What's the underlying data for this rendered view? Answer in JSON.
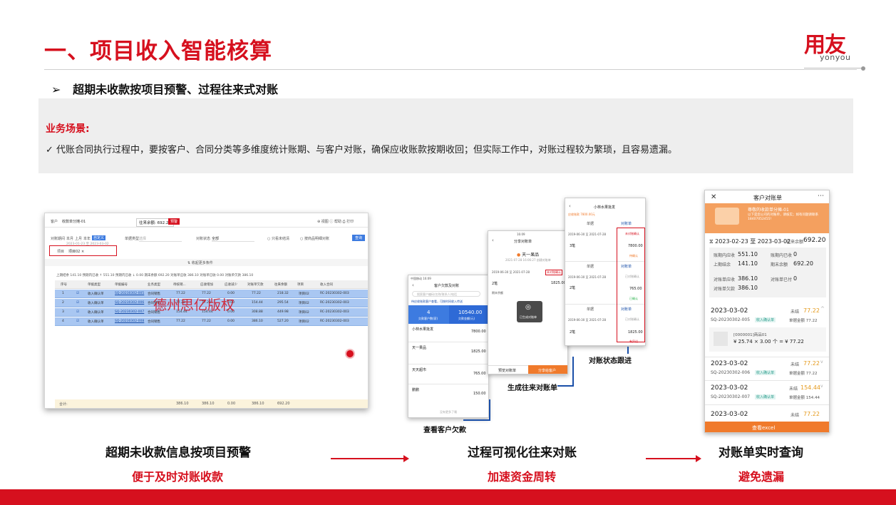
{
  "header": {
    "title": "一、项目收入智能核算",
    "logo_main": "用友",
    "logo_sub": "yonyou"
  },
  "subtitle": {
    "bullet": "➢",
    "text": "超期未收款按项目预警、过程往来式对账"
  },
  "scenario": {
    "title": "业务场景:",
    "text": "✓ 代账合同执行过程中，要按客户、合同分类等多维度统计账期、与客户对账，确保应收账款按期收回；但实际工作中，对账过程较为繁琐，且容易遗漏。"
  },
  "shot1": {
    "customer_label": "客户",
    "customer_value": "收款单分摊-01",
    "balance": "往来余额: 692.20",
    "tag": "预警",
    "toolbar": "⊕ 视图  ⓘ 帮助  ⎙ 打印",
    "filter_period_label": "对账期间",
    "filter_periods": [
      "本月",
      "上月",
      "本年",
      "自定义"
    ],
    "date_range": "2023-01-23 至 2023-03-02",
    "filter_type_label": "单据类型",
    "filter_type_value": "选择",
    "filter_status_label": "对账状态",
    "filter_status_value": "全部",
    "check1": "只看未结清",
    "check2": "按商品明细对账",
    "query_button": "查询",
    "project_label": "项目",
    "project_value": "项目02 ×",
    "more_filters": "⇅ 收起更多条件",
    "summary": "上期结余  141.10    预期内已收  ↑ 551.10    预期内已收  ↓ 0.00    期末余额  692.20        对账单应收  386.10    对账单已收  0.00    对账单欠款  386.10",
    "columns": [
      "序号",
      "单据类型",
      "单据编号",
      "业务类型",
      "待核销...",
      "应收增加",
      "应收减少",
      "对账单欠款",
      "往来余额",
      "项目",
      "收入合同"
    ],
    "rows": [
      [
        "1",
        "收入确认单",
        "SQ-20230302-005",
        "合同销售",
        "77.22",
        "77.22",
        "0.00",
        "77.22",
        "218.32",
        "项目02",
        "RC-20230302-003"
      ],
      [
        "2",
        "收入确认单",
        "SQ-20230302-006",
        "合同销售",
        "77.22",
        "77.22",
        "0.00",
        "154.44",
        "295.54",
        "项目02",
        "RC-20230302-003"
      ],
      [
        "3",
        "收入确认单",
        "SQ-20230302-007",
        "合同销售",
        "154.44",
        "154.44",
        "0.00",
        "308.88",
        "449.98",
        "项目02",
        "RC-20230302-003"
      ],
      [
        "4",
        "收入确认单",
        "SQ-20230302-008",
        "合同销售",
        "77.22",
        "77.22",
        "0.00",
        "386.10",
        "527.20",
        "项目02",
        "RC-20230302-003"
      ]
    ],
    "total_label": "合计:",
    "totals": [
      "386.10",
      "386.10",
      "0.00",
      "386.10",
      "692.20"
    ],
    "watermark": "德州思亿版权"
  },
  "shot2": {
    "status": "中国移动  16:09",
    "title": "客户欠款及对账",
    "search_placeholder": "搜索客户编码/名称/联系人/电话",
    "tabs": "待应收账款客户查看，可按时间收入传送",
    "stat1_val": "4",
    "stat1_lbl": "欠款客户数(家)",
    "stat2_val": "10540.00",
    "stat2_lbl": "欠款金额(元)",
    "items": [
      {
        "name": "小林水果批发",
        "amt": "7800.00"
      },
      {
        "name": "天一果品",
        "amt": "1825.00"
      },
      {
        "name": "天天超市",
        "amt": "765.00"
      },
      {
        "name": "鹏鹏",
        "amt": "150.00"
      }
    ],
    "footer": "没有更多了噢"
  },
  "shot3": {
    "status": "16:09",
    "title": "分享对账单",
    "shop": "天一果品",
    "date": "2021-07-28 16:06:27 创建对账单",
    "range": "2019-06-30 至 2021-07-28",
    "tag": "未对账确认",
    "row1_lbl": "2笔",
    "row1_amt": "1825.00",
    "row2_lbl": "期末余额",
    "overlay": "已生成对账单",
    "btn1": "预览对账单",
    "btn2": "分享给客户"
  },
  "shot4": {
    "title": "小林水果批发",
    "sub": "应收账款 7800.00元",
    "col1": "单据",
    "col2": "对账单",
    "blocks": [
      {
        "range": "2019-06-30 至 2021-07-28",
        "tag": "未对账确认",
        "cnt": "3笔",
        "amt": "7800.00",
        "note": "待确认"
      },
      {
        "range": "2019-06-30 至 2021-07-28",
        "tag": "已对账确认",
        "cnt": "2笔",
        "amt": "765.00",
        "note": "已确认"
      },
      {
        "range": "2019-06-30 至 2021-07-28",
        "tag": "已对账确认",
        "cnt": "2笔",
        "amt": "1825.00",
        "note": "有异议"
      }
    ]
  },
  "shot5": {
    "title": "客户对账单",
    "banner_title": "尊敬的收款单分摊-01",
    "banner_text": "以下是您公司的对账单，请核实；如有问题请联系18407052455!",
    "period": "2023-02-23 至 2023-03-02",
    "balance_label": "往来余额",
    "balance": "692.20",
    "stats": [
      [
        "账期内应收",
        "551.10",
        "账期内已收",
        "0"
      ],
      [
        "上期结余",
        "141.10",
        "期末余额",
        "692.20"
      ],
      [
        "对账单应收",
        "386.10",
        "对账单已付",
        "0"
      ],
      [
        "对账单欠款",
        "386.10",
        "",
        ""
      ]
    ],
    "entries": [
      {
        "date": "2023-03-02",
        "status": "未结",
        "amt": "77.22",
        "no": "SQ-20230302-005",
        "tag": "收入确认单",
        "total": "单据金额 77.22"
      },
      {
        "date": "2023-03-02",
        "status": "未结",
        "amt": "77.22",
        "no": "SQ-20230302-006",
        "tag": "收入确认单",
        "total": "单据金额 77.22"
      },
      {
        "date": "2023-03-02",
        "status": "未结",
        "amt": "154.44",
        "no": "SQ-20230302-007",
        "tag": "收入确认单",
        "total": "单据金额 154.44"
      },
      {
        "date": "2023-03-02",
        "status": "未结",
        "amt": "77.22",
        "no": "",
        "tag": "",
        "total": ""
      }
    ],
    "goods_name": "[0000001]商品01",
    "goods_calc": "¥ 25.74 × 3.00 个 = ¥ 77.22",
    "excel_button": "查看excel"
  },
  "callouts": {
    "view_debt": "查看客户欠款",
    "gen_statement": "生成往来对账单",
    "track_status": "对账状态跟进"
  },
  "captions": [
    {
      "main": "超期未收款信息按项目预警",
      "sub": "便于及时对账收款"
    },
    {
      "main": "过程可视化往来对账",
      "sub": "加速资金周转"
    },
    {
      "main": "对账单实时查询",
      "sub": "避免遗漏"
    }
  ],
  "colors": {
    "brand": "#d6101e",
    "accent_blue": "#1a4fa8",
    "orange": "#f07a2b"
  }
}
